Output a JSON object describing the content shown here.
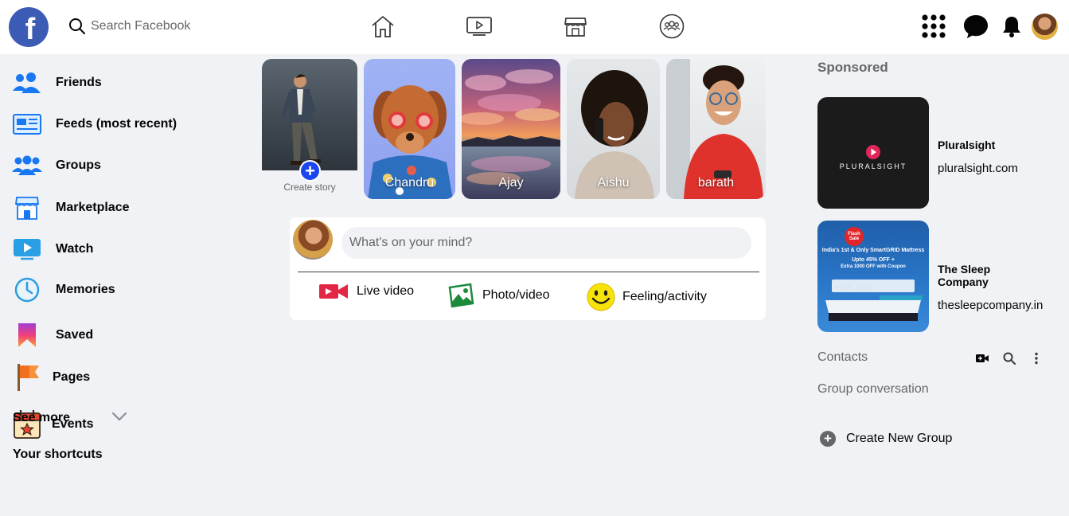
{
  "header": {
    "logo_letter": "f",
    "search_placeholder": "Search Facebook",
    "nav_icons": [
      "home-icon",
      "watch-icon",
      "marketplace-icon",
      "groups-icon"
    ],
    "right_icons": [
      "menu-grid-icon",
      "messenger-icon",
      "notifications-icon",
      "profile-avatar"
    ]
  },
  "sidebar": {
    "items": [
      {
        "label": "Friends",
        "icon": "friends-icon"
      },
      {
        "label": "Feeds (most recent)",
        "icon": "feeds-icon"
      },
      {
        "label": "Groups",
        "icon": "groups-icon"
      },
      {
        "label": "Marketplace",
        "icon": "marketplace-icon"
      },
      {
        "label": "Watch",
        "icon": "watch-icon"
      },
      {
        "label": "Memories",
        "icon": "memories-icon"
      },
      {
        "label": "Saved",
        "icon": "saved-icon"
      },
      {
        "label": "Pages",
        "icon": "pages-icon"
      },
      {
        "label": "Events",
        "icon": "events-icon"
      }
    ],
    "see_more": "See more",
    "shortcuts_heading": "Your shortcuts"
  },
  "stories": {
    "create_label": "Create story",
    "items": [
      {
        "name": "Chandru"
      },
      {
        "name": "Ajay"
      },
      {
        "name": "Aishu"
      },
      {
        "name": "barath"
      }
    ]
  },
  "composer": {
    "placeholder": "What's on your mind?",
    "actions": [
      {
        "label": "Live video",
        "icon": "live-video-icon",
        "color": "#e42645"
      },
      {
        "label": "Photo/video",
        "icon": "photo-video-icon",
        "color": "#1b8a3c"
      },
      {
        "label": "Feeling/activity",
        "icon": "feeling-icon",
        "color": "#f7d70a"
      }
    ]
  },
  "right": {
    "sponsored_title": "Sponsored",
    "ads": [
      {
        "name": "Pluralsight",
        "url": "pluralsight.com",
        "brand_text": "PLURALSIGHT"
      },
      {
        "name": "The Sleep Company",
        "url": "thesleepcompany.in",
        "promo_headline": "India's 1st & Only SmartGRID Mattress",
        "promo_offer": "Upto 45% OFF +",
        "promo_coupon": "Extra 1000 OFF with Coupon",
        "sale_badge": "Flash Sale"
      }
    ],
    "contacts_label": "Contacts",
    "group_conversation": "Group conversation",
    "create_group": "Create New Group"
  },
  "colors": {
    "brand_blue": "#3b5bb5",
    "page_bg": "#f0f2f5",
    "secondary_text": "#65676b"
  }
}
